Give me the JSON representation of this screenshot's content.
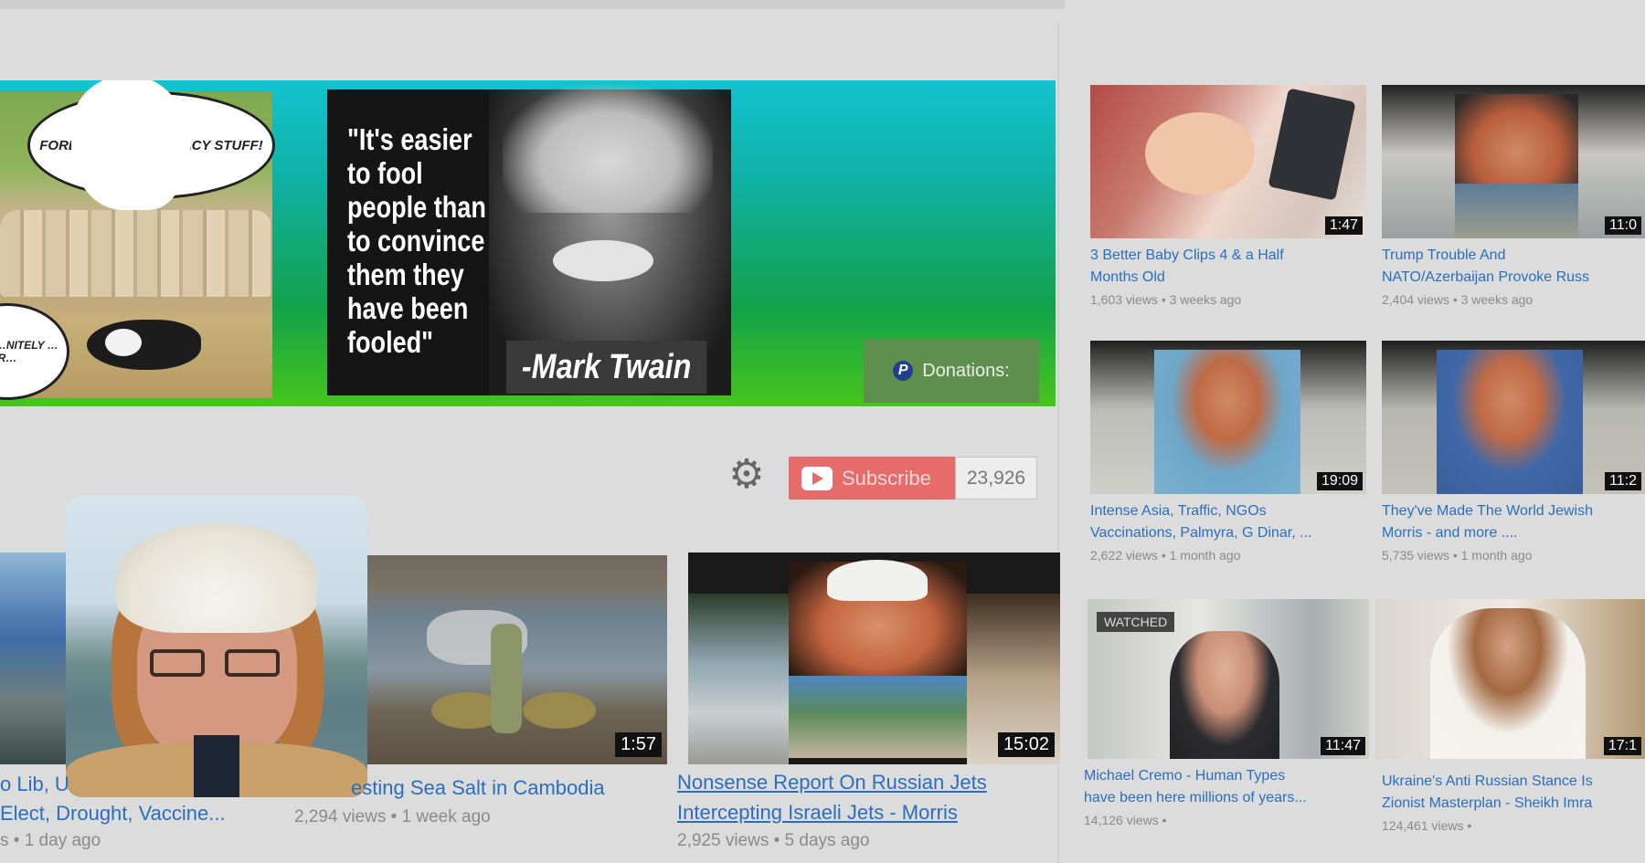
{
  "banner": {
    "bubble_top": "FOREVOR, …THAT …ACY STUFF!",
    "bubble_left": "…MAN …NITELY …R…",
    "quote": "\"It's easier to fool people than to convince them they have been fooled\"",
    "author": "-Mark Twain",
    "donations_label": "Donations:",
    "paypal_mark": "P"
  },
  "channel": {
    "settings_icon": "gear-icon",
    "subscribe_label": "Subscribe",
    "subscriber_count": "23,926"
  },
  "bottom_videos": [
    {
      "title_line1": "o Lib, U",
      "title_line2": "Elect, Drought, Vaccine...",
      "meta": "s • 1 day ago"
    },
    {
      "title_line1": "esting Sea Salt in Cambodia",
      "meta": "2,294 views • 1 week ago",
      "duration": "1:57"
    },
    {
      "title_line1": "Nonsense Report On Russian Jets",
      "title_line2": "Intercepting Israeli Jets - Morris",
      "meta": "2,925 views • 5 days ago",
      "duration": "15:02"
    }
  ],
  "right_videos": [
    {
      "title_line1": "3 Better Baby Clips 4 & a Half",
      "title_line2": "Months Old",
      "meta": "1,603 views • 3 weeks ago",
      "duration": "1:47"
    },
    {
      "title_line1": "Trump Trouble And",
      "title_line2": "NATO/Azerbaijan Provoke Russ",
      "meta": "2,404 views • 3 weeks ago",
      "duration": "11:0"
    },
    {
      "title_line1": "Intense Asia, Traffic, NGOs",
      "title_line2": "Vaccinations, Palmyra, G Dinar, ...",
      "meta": "2,622 views • 1 month ago",
      "duration": "19:09"
    },
    {
      "title_line1": "They've Made The World Jewish",
      "title_line2": "Morris - and more ....",
      "meta": "5,735 views • 1 month ago",
      "duration": "11:2"
    },
    {
      "title_line1": "Michael Cremo - Human Types",
      "title_line2": "have been here millions of years...",
      "meta": "14,126 views •",
      "duration": "11:47",
      "badge": "WATCHED"
    },
    {
      "title_line1": "Ukraine's Anti Russian Stance Is",
      "title_line2": "Zionist Masterplan - Sheikh Imra",
      "meta": "124,461 views •",
      "duration": "17:1"
    }
  ]
}
